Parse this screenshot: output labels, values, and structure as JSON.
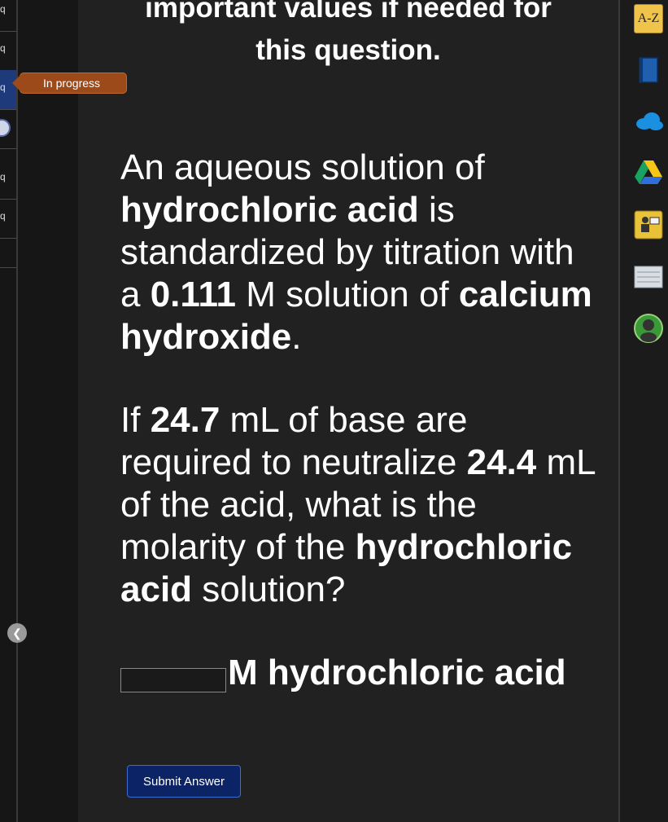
{
  "intro": {
    "line1": "important values if needed for",
    "line2": "this question."
  },
  "status": {
    "label": "In progress"
  },
  "nav": {
    "items": [
      {
        "label": "q",
        "state": "default"
      },
      {
        "label": "q",
        "state": "default"
      },
      {
        "label": "q",
        "state": "active"
      },
      {
        "label": "",
        "state": "current"
      },
      {
        "label": "q",
        "state": "default"
      },
      {
        "label": "q",
        "state": "default"
      }
    ]
  },
  "question": {
    "p1": {
      "t1": "An aqueous solution of ",
      "b1": "hydrochloric acid",
      "t2": " is standardized by titration with a ",
      "b2": "0.111",
      "t3": " M solution of ",
      "b3": "calcium hydroxide",
      "t4": "."
    },
    "p2": {
      "t1": "If ",
      "b1": "24.7",
      "t2": " mL of base are required to neutralize ",
      "b2": "24.4",
      "t3": " mL of the acid, what is the molarity of the ",
      "b3": "hydrochloric acid",
      "t4": " solution?"
    }
  },
  "answer": {
    "value": "",
    "unit": "M hydrochloric acid"
  },
  "submit": {
    "label": "Submit Answer"
  },
  "tools": {
    "az_label": "A-Z",
    "items": [
      "glossary-icon",
      "book-icon",
      "onedrive-icon",
      "google-drive-icon",
      "tutor-icon",
      "notes-icon",
      "profile-icon"
    ]
  },
  "colors": {
    "status": "#9d4a1a",
    "submit": "#0c2366",
    "active_nav": "#1f3a7a",
    "background": "#212121"
  }
}
